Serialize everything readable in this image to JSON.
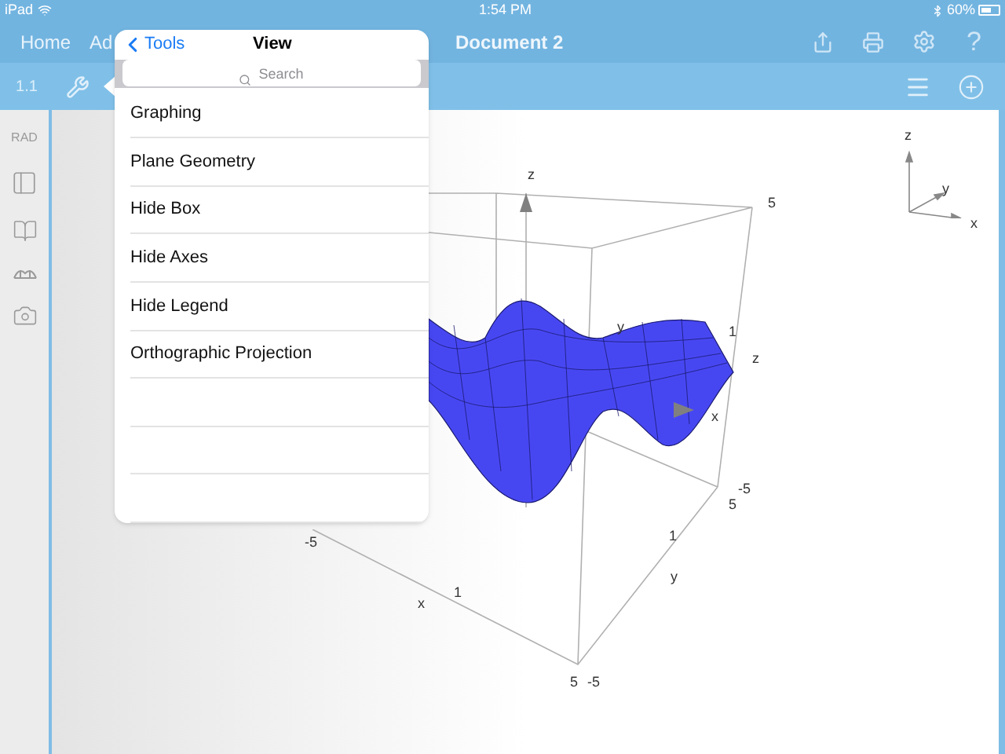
{
  "status_bar": {
    "device": "iPad",
    "time": "1:54 PM",
    "battery": "60%"
  },
  "title_bar": {
    "tabs": [
      "Home",
      "Ad"
    ],
    "document": "Document 2",
    "help": "?"
  },
  "toolbar": {
    "page": "1.1"
  },
  "sidebar": {
    "mode": "RAD"
  },
  "graph": {
    "labels": [
      {
        "text": "z"
      },
      {
        "text": "5"
      },
      {
        "text": "y"
      },
      {
        "text": "1"
      },
      {
        "text": "z"
      },
      {
        "text": "x"
      },
      {
        "text": "-5"
      },
      {
        "text": "5"
      },
      {
        "text": "-5"
      },
      {
        "text": "1"
      },
      {
        "text": "y"
      },
      {
        "text": "x"
      },
      {
        "text": "1"
      },
      {
        "text": "5"
      },
      {
        "text": "-5"
      }
    ],
    "mini_axes": [
      {
        "text": "z"
      },
      {
        "text": "y"
      },
      {
        "text": "x"
      }
    ]
  },
  "popover": {
    "back": "Tools",
    "title": "View",
    "search": {
      "placeholder": "Search"
    },
    "items": [
      "Graphing",
      "Plane Geometry",
      "Hide Box",
      "Hide Axes",
      "Hide Legend",
      "Orthographic Projection"
    ]
  }
}
